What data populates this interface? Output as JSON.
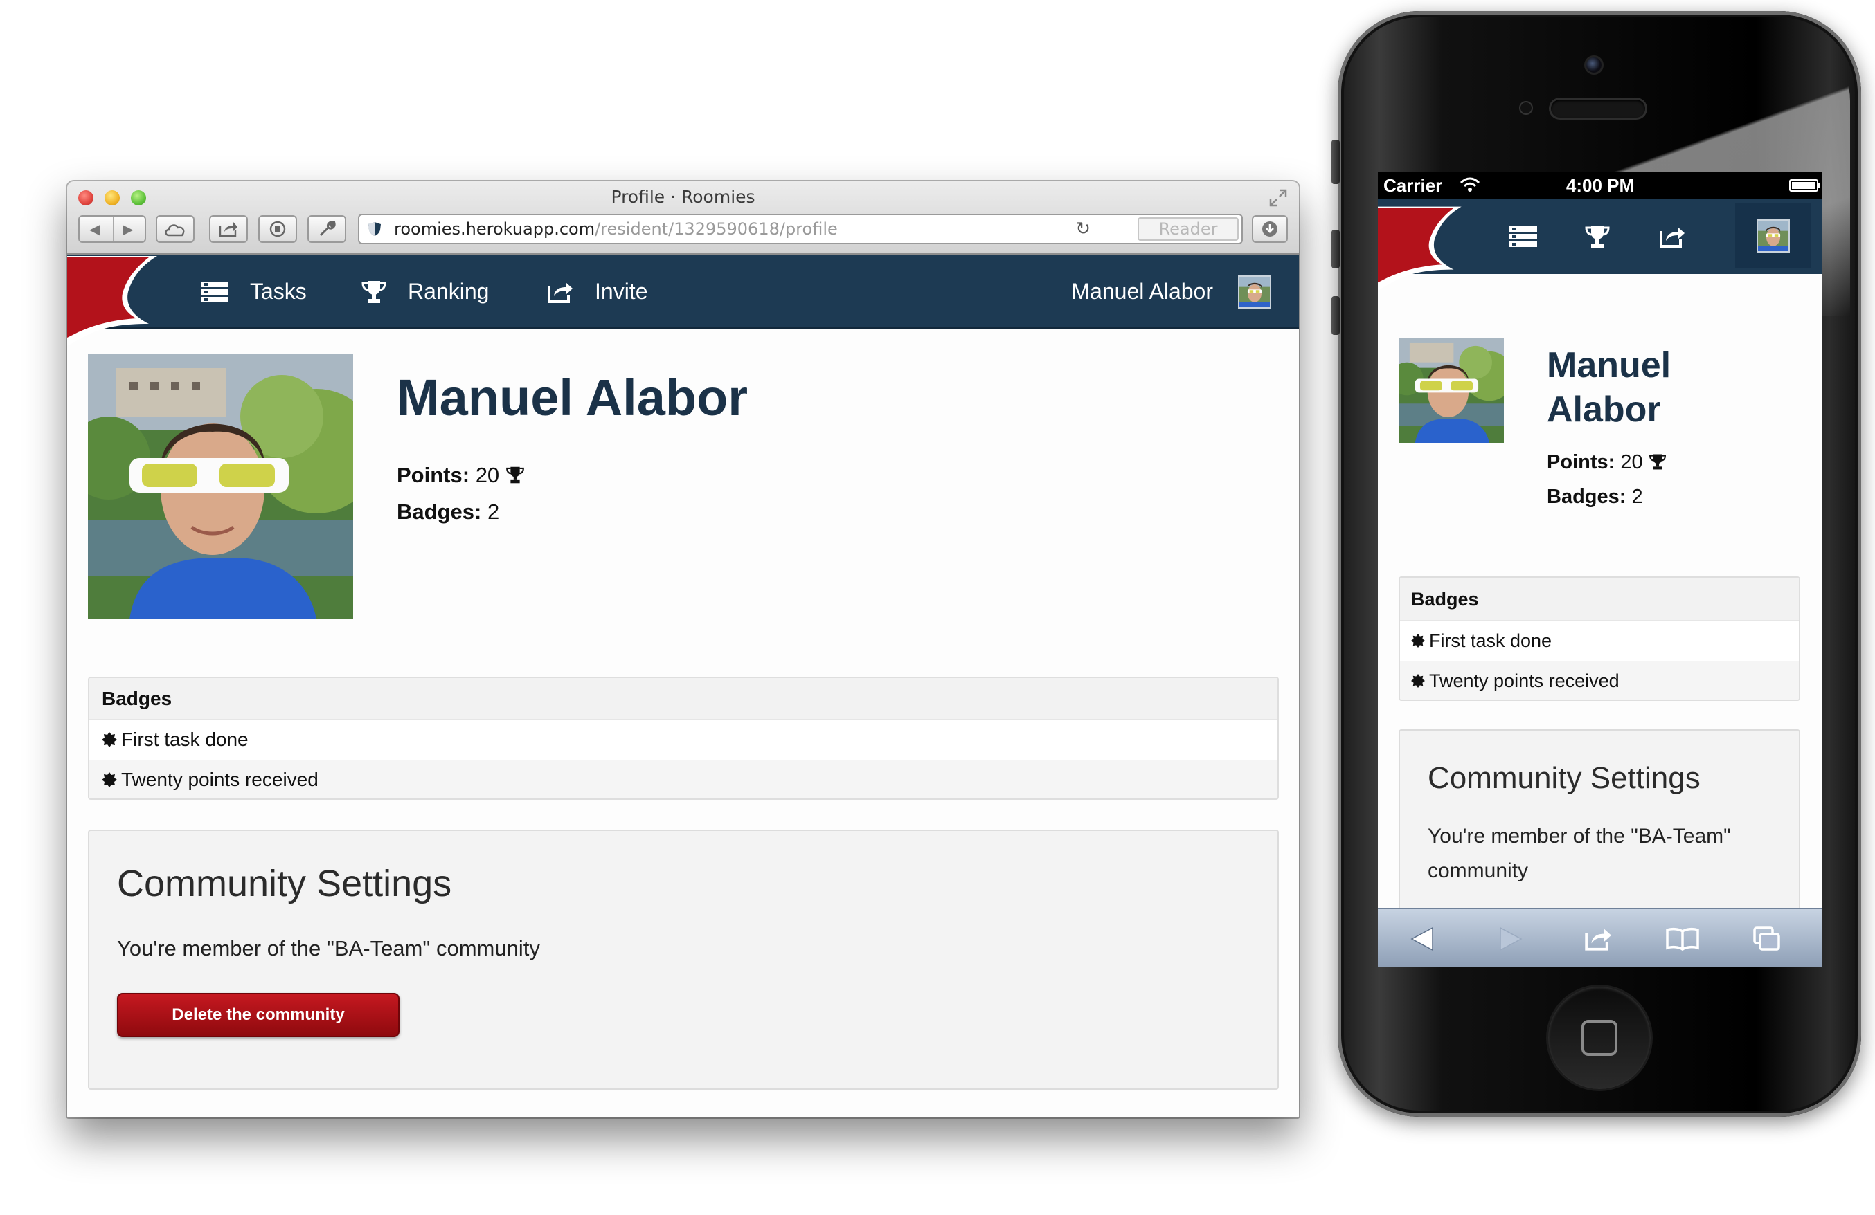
{
  "browser": {
    "window_title": "Profile · Roomies",
    "url_host": "roomies.herokuapp.com",
    "url_path": "/resident/1329590618/profile",
    "reader_label": "Reader"
  },
  "nav": {
    "tasks_label": "Tasks",
    "ranking_label": "Ranking",
    "invite_label": "Invite",
    "user_name": "Manuel Alabor"
  },
  "profile": {
    "name": "Manuel Alabor",
    "name_line1": "Manuel",
    "name_line2": "Alabor",
    "points_label": "Points:",
    "points_value": "20",
    "badges_label": "Badges:",
    "badges_value": "2"
  },
  "badges_table": {
    "header": "Badges",
    "rows": [
      "First task done",
      "Twenty points received"
    ]
  },
  "community": {
    "title": "Community Settings",
    "text": "You're member of the \"BA-Team\" community",
    "delete_label": "Delete the community"
  },
  "phone": {
    "carrier": "Carrier",
    "time": "4:00 PM"
  },
  "colors": {
    "navbar": "#1d3a53",
    "brand_red": "#b3121b",
    "heading": "#1b3248",
    "danger": "#a50f15"
  },
  "icons": [
    "tasks-icon",
    "trophy-icon",
    "share-icon",
    "badge-icon",
    "back-arrow-icon",
    "forward-arrow-icon",
    "bookmarks-icon",
    "tabs-icon"
  ]
}
